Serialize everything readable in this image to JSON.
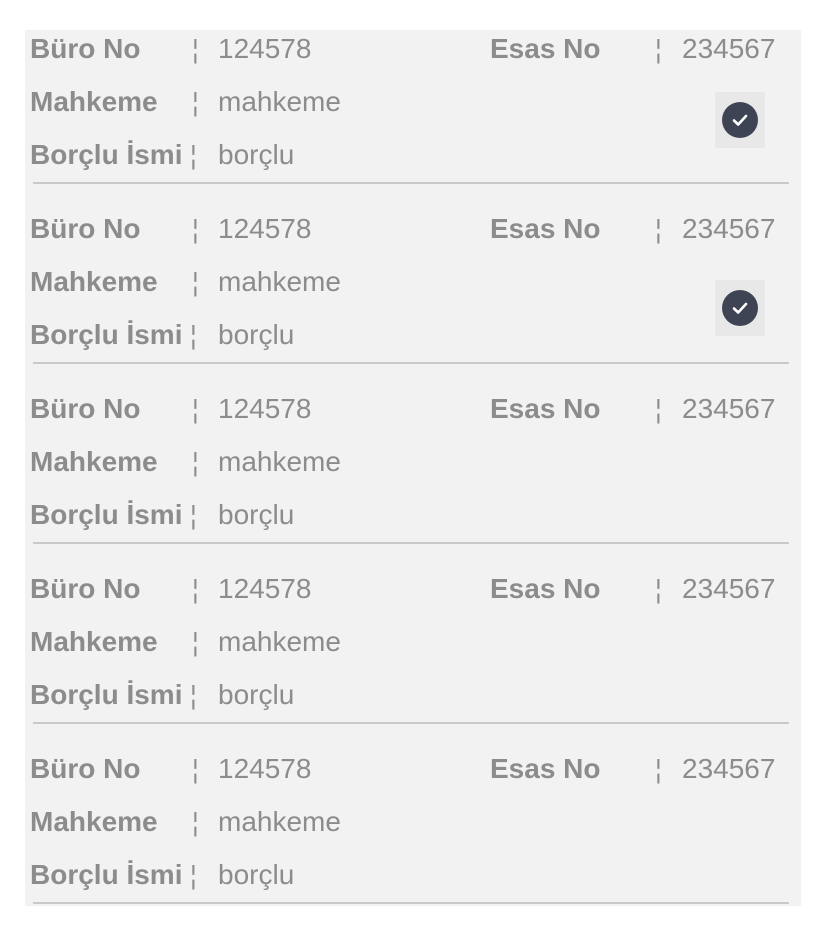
{
  "labels": {
    "buro_no": "Büro No",
    "mahkeme": "Mahkeme",
    "borclu_ismi": "Borçlu İsmi",
    "esas_no": "Esas No",
    "separator": "¦"
  },
  "records": [
    {
      "buro_no": "124578",
      "mahkeme": "mahkeme",
      "borclu": "borçlu",
      "esas_no": "234567",
      "checked": true
    },
    {
      "buro_no": "124578",
      "mahkeme": "mahkeme",
      "borclu": "borçlu",
      "esas_no": "234567",
      "checked": true
    },
    {
      "buro_no": "124578",
      "mahkeme": "mahkeme",
      "borclu": "borçlu",
      "esas_no": "234567",
      "checked": false
    },
    {
      "buro_no": "124578",
      "mahkeme": "mahkeme",
      "borclu": "borçlu",
      "esas_no": "234567",
      "checked": false
    },
    {
      "buro_no": "124578",
      "mahkeme": "mahkeme",
      "borclu": "borçlu",
      "esas_no": "234567",
      "checked": false
    }
  ],
  "check_icon": "check-circle-icon",
  "colors": {
    "text": "#8c8c8c",
    "panel_bg": "#f2f2f2",
    "divider": "#c9c9c9",
    "check_fill": "#3f4455"
  }
}
